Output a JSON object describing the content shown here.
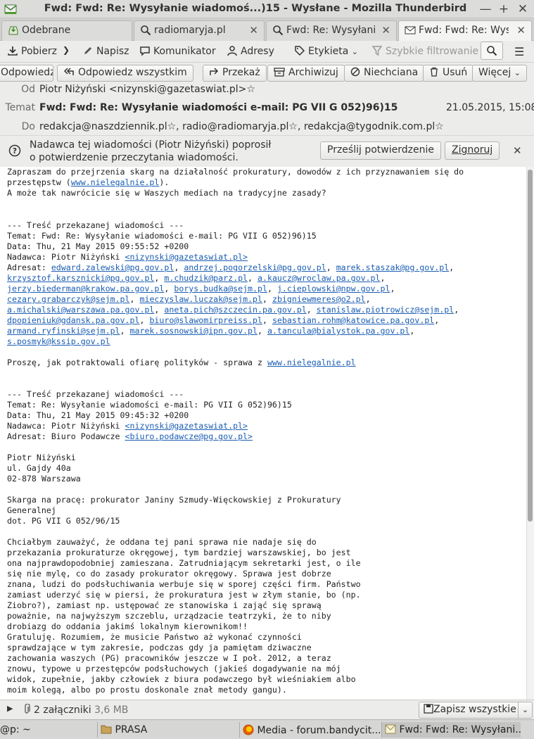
{
  "window": {
    "title": "Fwd: Fwd: Re: Wysyłanie wiadomoś...)15 - Wysłane - Mozilla Thunderbird"
  },
  "tabs": [
    {
      "label": "Odebrane",
      "icon": "inbox-icon"
    },
    {
      "label": "radiomaryja.pl",
      "icon": "search-icon"
    },
    {
      "label": "Fwd: Re: Wysyłanie",
      "icon": "search-icon"
    },
    {
      "label": "Fwd: Fwd: Re: Wysy",
      "icon": "envelope-icon"
    }
  ],
  "toolbar": {
    "get_label": "Pobierz",
    "write_label": "Napisz",
    "chat_label": "Komunikator",
    "address_label": "Adresy",
    "tag_label": "Etykieta",
    "filter_label": "Szybkie filtrowanie"
  },
  "actions": {
    "reply": "Odpowiedz",
    "reply_all": "Odpowiedz wszystkim",
    "forward": "Przekaż",
    "archive": "Archiwizuj",
    "junk": "Niechciana",
    "delete": "Usuń",
    "more": "Więcej"
  },
  "header": {
    "from_label": "Od",
    "from_value": "Piotr Niżyński <nizynski@gazetaswiat.pl>",
    "subject_label": "Temat",
    "subject_value": "Fwd: Fwd: Re: Wysyłanie wiadomości e-mail: PG VII G 052)96)15",
    "date": "21.05.2015, 15:08",
    "to_label": "Do",
    "to_1": "redakcja@naszdziennik.pl",
    "to_2": ", radio@radiomaryja.pl",
    "to_3": ", redakcja@tygodnik.com.pl"
  },
  "notification": {
    "line1": "Nadawca tej wiadomości (Piotr Niżyński) poprosił",
    "line2": "o potwierdzenie przeczytania wiadomości.",
    "send_label": "Prześlij potwierdzenie",
    "ignore_label": "Zignoruj"
  },
  "body": {
    "l1": "Zapraszam do przejrzenia skarg na działalność prokuratury, dowodów z ich przyznawaniem się do",
    "l2a": "przestępstw (",
    "l2link": "www.nielegalnie.pl",
    "l2b": ").",
    "l3": "A może tak nawrócicie się w Waszych mediach na tradycyjne zasady?",
    "f1_sep": "--- Treść przekazanej wiadomości ---",
    "f1_subject": "Temat: Fwd: Re: Wysyłanie wiadomości e-mail: PG VII G 052)96)15",
    "f1_date": "Data: Thu, 21 May 2015 09:55:52 +0200",
    "f1_from": "Nadawca: Piotr Niżyński ",
    "f1_from_link": "<nizynski@gazetaswiat.pl>",
    "f1_to_label": "Adresat: ",
    "recipients": [
      "edward.zalewski@pg.gov.pl",
      "andrzej.pogorzelski@pg.gov.pl",
      "marek.staszak@pg.gov.pl",
      "krzysztof.karsznicki@pg.gov.pl",
      "m.chudzik@parz.pl",
      "a.kaucz@wroclaw.pa.gov.pl",
      "jerzy.biederman@krakow.pa.gov.pl",
      "borys.budka@sejm.pl",
      "j.cieplowski@npw.gov.pl",
      "cezary.grabarczyk@sejm.pl",
      "mieczyslaw.luczak@sejm.pl",
      "zbigniewmeres@o2.pl",
      "a.michalski@warszawa.pa.gov.pl",
      "aneta.pich@szczecin.pa.gov.pl",
      "stanislaw.piotrowicz@sejm.pl",
      "dpopieniuk@gdansk.pa.gov.pl",
      "biuro@slawomirpreiss.pl",
      "sebastian.rohm@katowice.pa.gov.pl",
      "armand.ryfinski@sejm.pl",
      "marek.sosnowski@ipn.gov.pl",
      "a.tancula@bialystok.pa.gov.pl",
      "s.posmyk@kssip.gov.pl"
    ],
    "f1_text": "Proszę, jak potraktowali ofiarę polityków - sprawa z ",
    "f1_text_link": "www.nielegalnie.pl",
    "f2_sep": "--- Treść przekazanej wiadomości ---",
    "f2_subject": "Temat: Re: Wysyłanie wiadomości e-mail: PG VII G 052)96)15",
    "f2_date": "Data: Thu, 21 May 2015 09:45:32 +0200",
    "f2_from": "Nadawca: Piotr Niżyński ",
    "f2_from_link": "<nizynski@gazetaswiat.pl>",
    "f2_to": "Adresat: Biuro Podawcze ",
    "f2_to_link": "<biuro.podawcze@pg.gov.pl>",
    "addr1": "Piotr Niżyński",
    "addr2": "ul. Gajdy 40a",
    "addr3": "02-878 Warszawa",
    "c1": "Skarga na pracę: prokurator Janiny Szmudy-Więckowskiej z Prokuratury",
    "c2": "Generalnej",
    "c3": "dot. PG VII G 052/96/15",
    "p1": "Chciałbym zauważyć, że oddana tej pani sprawa nie nadaje się do",
    "p2": "przekazania prokuraturze okręgowej, tym bardziej warszawskiej, bo jest",
    "p3": "ona najprawdopodobniej zamieszana. Zatrudniającym sekretarki jest, o ile",
    "p4": "się nie mylę, co do zasady prokurator okręgowy. Sprawa jest dobrze",
    "p5": "znana, ludzi do podsłuchiwania werbuje się w sporej części firm. Państwo",
    "p6": "zamiast uderzyć się w piersi, że prokuratura jest w złym stanie, bo (np.",
    "p7": "Ziobro?), zamiast np. ustępować ze stanowiska i zająć się sprawą",
    "p8": "poważnie, na najwyższym szczeblu, urządzacie teatrzyki, że to niby",
    "p9": "drobiazg do oddania jakimś lokalnym kierownikom!!",
    "p10": "Gratuluję. Rozumiem, że musicie Państwo aż wykonać czynności",
    "p11": "sprawdzające w tym zakresie, podczas gdy ja pamiętam dziwaczne",
    "p12": "zachowania waszych (PG) pracowników jeszcze w I poł. 2012, a teraz",
    "p13": "znowu, typowe u przestępców podsłuchowych (jakieś dogadywanie na mój",
    "p14": "widok, zupełnie, jakby człowiek z biura podawczego był wieśniakiem albo",
    "p15": "moim kolegą, albo po prostu doskonale znał metody gangu)."
  },
  "attachments": {
    "count_label": "2 załączniki",
    "size": "3,6 MB",
    "save_all_label": "Zapisz wszystkie"
  },
  "taskbar": {
    "terminal": "@p: ~",
    "folder": "PRASA",
    "browser": "Media - forum.bandycit...",
    "mail": "Fwd: Fwd: Re: Wysyłani..."
  },
  "colors": {
    "link": "#1a5db3",
    "window_bg": "#ececeb",
    "title_bg": "#dcdcda"
  }
}
